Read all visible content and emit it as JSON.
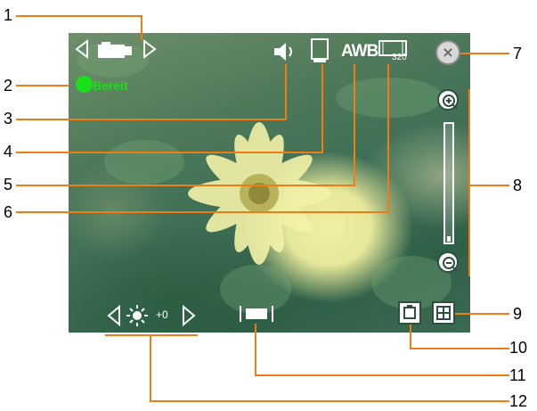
{
  "viewfinder": {
    "status_text": "Bereit",
    "icons": {
      "mode": "camcorder-mode-icon",
      "sound": "speaker-icon",
      "storage": "memory-card-icon",
      "white_balance_label": "AWB",
      "resolution_label": "320",
      "close": "close-icon",
      "zoom_in": "zoom-in-icon",
      "zoom_out": "zoom-out-icon",
      "settings": "camera-settings-icon",
      "menu": "grid-menu-icon",
      "frame": "frame-icon",
      "brightness": "brightness-icon"
    },
    "zoom_level_fraction": 0.0,
    "exposure_value": "+0"
  },
  "callouts": {
    "numbers": [
      "1",
      "2",
      "3",
      "4",
      "5",
      "6",
      "7",
      "8",
      "9",
      "10",
      "11",
      "12"
    ]
  },
  "colors": {
    "leader_lines": "#f07d13",
    "status_green": "#18e018"
  }
}
